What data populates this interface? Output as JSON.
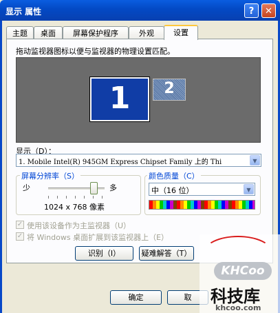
{
  "window": {
    "title": "显示 属性",
    "help": "?",
    "close": "✕"
  },
  "tabs": [
    "主题",
    "桌面",
    "屏幕保护程序",
    "外观",
    "设置"
  ],
  "instructions": "拖动监视器图标以便与监视器的物理设置匹配。",
  "monitors": {
    "primary": "1",
    "secondary": "2"
  },
  "display": {
    "label": "显示（D）：",
    "value": "1. Mobile Intel(R) 945GM Express Chipset Family 上的 Thi"
  },
  "resolution": {
    "legend": "屏幕分辨率（S）",
    "less": "少",
    "more": "多",
    "value": "1024 x 768 像素"
  },
  "color": {
    "legend": "颜色质量（C）",
    "value": "中（16 位）"
  },
  "options": {
    "primary_monitor": "使用该设备作为主监视器（U）",
    "extend_desktop": "将 Windows 桌面扩展到该监视器上（E）"
  },
  "buttons": {
    "identify": "识别（I）",
    "troubleshoot": "疑难解答（T）",
    "ok": "确定",
    "cancel": "取"
  },
  "watermark": {
    "logo": "KHCoo",
    "name": "科技库",
    "url": "khcoo.com"
  },
  "colors": {
    "titlebar": "#0349c4",
    "accent_tab": "#ffc83c",
    "group_legend": "#0046d5"
  }
}
